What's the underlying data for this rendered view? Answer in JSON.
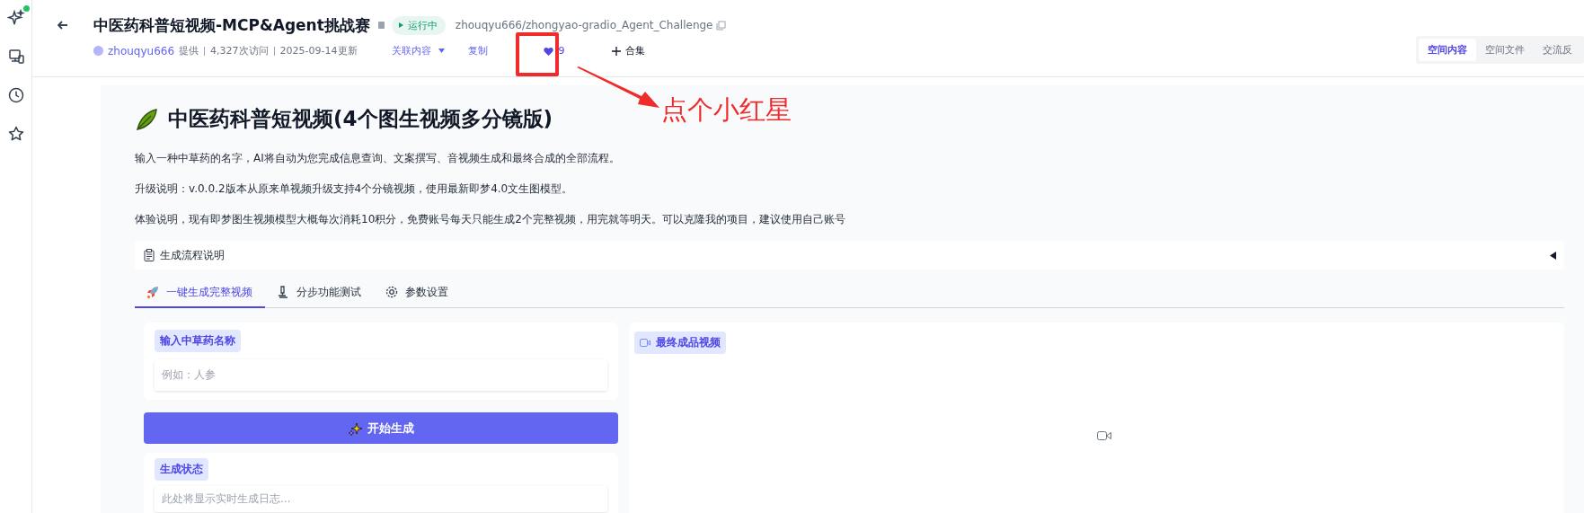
{
  "sidebar": {
    "items": [
      {
        "kind": "sparkle",
        "badge": true
      },
      {
        "kind": "device",
        "badge": false
      },
      {
        "kind": "clock",
        "badge": false
      },
      {
        "kind": "star",
        "badge": false
      }
    ]
  },
  "header": {
    "title": "中医药科普短视频-MCP&Agent挑战赛",
    "status": "运行中",
    "repo": "zhouqyu666/zhongyao-gradio_Agent_Challenge",
    "author": "zhouqyu666",
    "provided": "提供",
    "visits": "4,327次访问",
    "updated": "2025-09-14更新",
    "related": "关联内容",
    "copy": "复制",
    "likes": "9",
    "collection": "合集"
  },
  "space_tabs": [
    {
      "label": "空间内容",
      "selected": true
    },
    {
      "label": "空间文件",
      "selected": false
    },
    {
      "label": "交流反",
      "selected": false
    }
  ],
  "app": {
    "title": "中医药科普短视频(4个图生视频多分镜版)",
    "paragraphs": [
      "输入一种中草药的名字，AI将自动为您完成信息查询、文案撰写、音视频生成和最终合成的全部流程。",
      "升级说明：v.0.0.2版本从原来单视频升级支持4个分镜视频，使用最新即梦4.0文生图模型。",
      "体验说明，现有即梦图生视频模型大概每次消耗10积分，免费账号每天只能生成2个完整视频，用完就等明天。可以克隆我的项目，建议使用自己账号"
    ],
    "accordion": {
      "label": "生成流程说明",
      "expanded": false
    },
    "tabs": [
      {
        "label": "一键生成完整视频",
        "selected": true,
        "kind": "rocket"
      },
      {
        "label": "分步功能测试",
        "selected": false,
        "kind": "flask"
      },
      {
        "label": "参数设置",
        "selected": false,
        "kind": "gear"
      }
    ],
    "input": {
      "label": "输入中草药名称",
      "placeholder": "例如：人参"
    },
    "generate_button": "开始生成",
    "status": {
      "label": "生成状态",
      "placeholder": "此处将显示实时生成日志..."
    },
    "video": {
      "label": "最终成品视频"
    }
  },
  "annotation": {
    "text": "点个小红星"
  }
}
